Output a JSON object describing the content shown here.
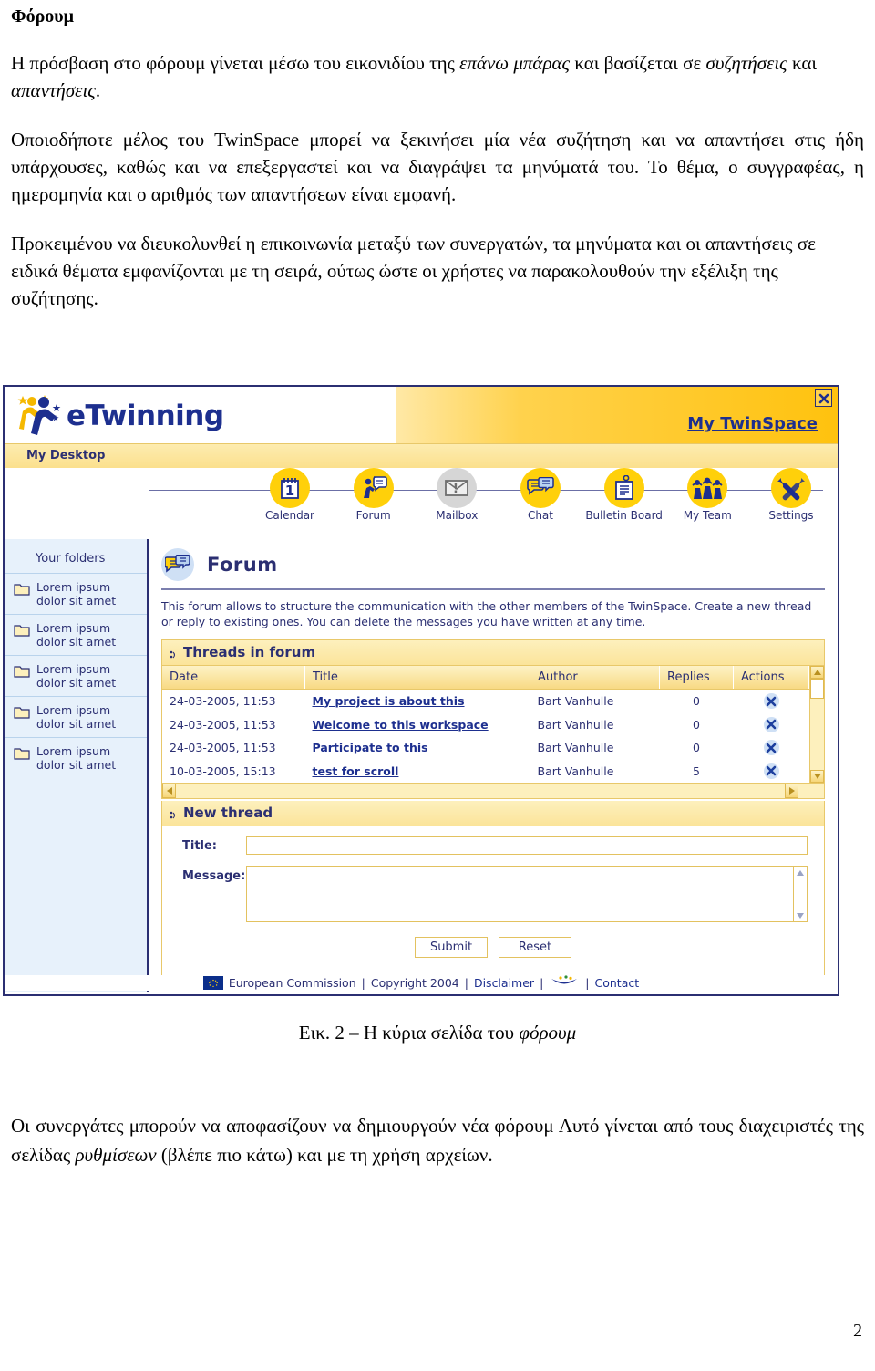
{
  "document": {
    "heading": "Φόρουμ",
    "paragraphs": [
      {
        "runs": [
          {
            "t": "Η πρόσβαση στο φόρουμ γίνεται μέσω του εικονιδίου της ",
            "i": false
          },
          {
            "t": "επάνω μπάρας",
            "i": true
          },
          {
            "t": " και βασίζεται σε ",
            "i": false
          },
          {
            "t": "συζητήσεις",
            "i": true
          },
          {
            "t": " και ",
            "i": false
          },
          {
            "t": "απαντήσεις",
            "i": true
          },
          {
            "t": ".",
            "i": false
          }
        ]
      },
      {
        "runs": [
          {
            "t": "Οποιοδήποτε μέλος του TwinSpace μπορεί να ξεκινήσει μία νέα συζήτηση και να απαντήσει στις ήδη υπάρχουσες, καθώς και να επεξεργαστεί και να διαγράψει τα μηνύματά του. Το θέμα, ο συγγραφέας, η ημερομηνία και ο αριθμός των απαντήσεων είναι εμφανή.",
            "i": false
          }
        ]
      },
      {
        "runs": [
          {
            "t": "Προκειμένου να διευκολυνθεί η επικοινωνία μεταξύ των συνεργατών, τα μηνύματα και οι απαντήσεις σε ειδικά θέματα εμφανίζονται με τη σειρά, ούτως ώστε οι χρήστες να παρακολουθούν την εξέλιξη της συζήτησης.",
            "i": false
          }
        ]
      }
    ],
    "figure_caption": {
      "prefix": "Εικ. 2 – Η κύρια σελίδα του ",
      "italic": "φόρουμ"
    },
    "bottom_paragraph": {
      "runs": [
        {
          "t": "Οι συνεργάτες μπορούν να αποφασίζουν να δημιουργούν νέα φόρουμ Αυτό γίνεται από τους διαχειριστές της σελίδας ",
          "i": false
        },
        {
          "t": "ρυθμίσεων",
          "i": true
        },
        {
          "t": " (βλέπε πιο κάτω) και με τη χρήση αρχείων.",
          "i": false
        }
      ]
    },
    "page_number": "2"
  },
  "screenshot": {
    "brand": {
      "logo_text": "eTwinning",
      "twinspace_link": "My TwinSpace",
      "close_label": "x"
    },
    "desktop_bar": {
      "label": "My Desktop"
    },
    "nav": [
      {
        "label": "Calendar",
        "icon": "calendar-icon",
        "state": "active"
      },
      {
        "label": "Forum",
        "icon": "forum-icon",
        "state": "active"
      },
      {
        "label": "Mailbox",
        "icon": "mailbox-icon",
        "state": "disabled"
      },
      {
        "label": "Chat",
        "icon": "chat-icon",
        "state": "active"
      },
      {
        "label": "Bulletin Board",
        "icon": "bulletin-board-icon",
        "state": "active"
      },
      {
        "label": "My Team",
        "icon": "my-team-icon",
        "state": "active"
      },
      {
        "label": "Settings",
        "icon": "settings-icon",
        "state": "active"
      }
    ],
    "sidebar": {
      "title": "Your folders",
      "folders": [
        {
          "line1": "Lorem ipsum",
          "line2": "dolor sit amet"
        },
        {
          "line1": "Lorem ipsum",
          "line2": "dolor sit amet"
        },
        {
          "line1": "Lorem ipsum",
          "line2": "dolor sit amet"
        },
        {
          "line1": "Lorem ipsum",
          "line2": "dolor sit amet"
        },
        {
          "line1": "Lorem ipsum",
          "line2": "dolor sit amet"
        }
      ]
    },
    "content": {
      "title": "Forum",
      "description": "This forum allows to structure the communication with the other members of the TwinSpace. Create a new thread or reply to existing ones. You can delete the messages you have written at any time.",
      "threads_panel": {
        "title": "Threads in forum",
        "columns": [
          "Date",
          "Title",
          "Author",
          "Replies",
          "Actions"
        ],
        "rows": [
          {
            "date": "24-03-2005, 11:53",
            "title": "My project is about this",
            "author": "Bart Vanhulle",
            "replies": "0",
            "action": "delete-icon"
          },
          {
            "date": "24-03-2005, 11:53",
            "title": "Welcome to this workspace",
            "author": "Bart Vanhulle",
            "replies": "0",
            "action": "delete-icon"
          },
          {
            "date": "24-03-2005, 11:53",
            "title": "Participate to this",
            "author": "Bart Vanhulle",
            "replies": "0",
            "action": "delete-icon"
          },
          {
            "date": "10-03-2005, 15:13",
            "title": "test for scroll",
            "author": "Bart Vanhulle",
            "replies": "5",
            "action": "delete-icon"
          }
        ]
      },
      "new_thread_panel": {
        "title": "New thread",
        "title_label": "Title:",
        "title_value": "",
        "message_label": "Message:",
        "message_value": "",
        "submit_label": "Submit",
        "reset_label": "Reset"
      }
    },
    "footer": {
      "commission": "European Commission",
      "sep1": "|",
      "copyright": "Copyright 2004",
      "sep2": "|",
      "disclaimer": "Disclaimer",
      "sep3": "|",
      "sep4": "|",
      "contact": "Contact"
    },
    "colors": {
      "brand_blue": "#1d2f8f",
      "brand_yellow": "#ffd00a",
      "panel_yellow": "#fbe49a",
      "sidebar_blue": "#e7f1fb"
    }
  }
}
